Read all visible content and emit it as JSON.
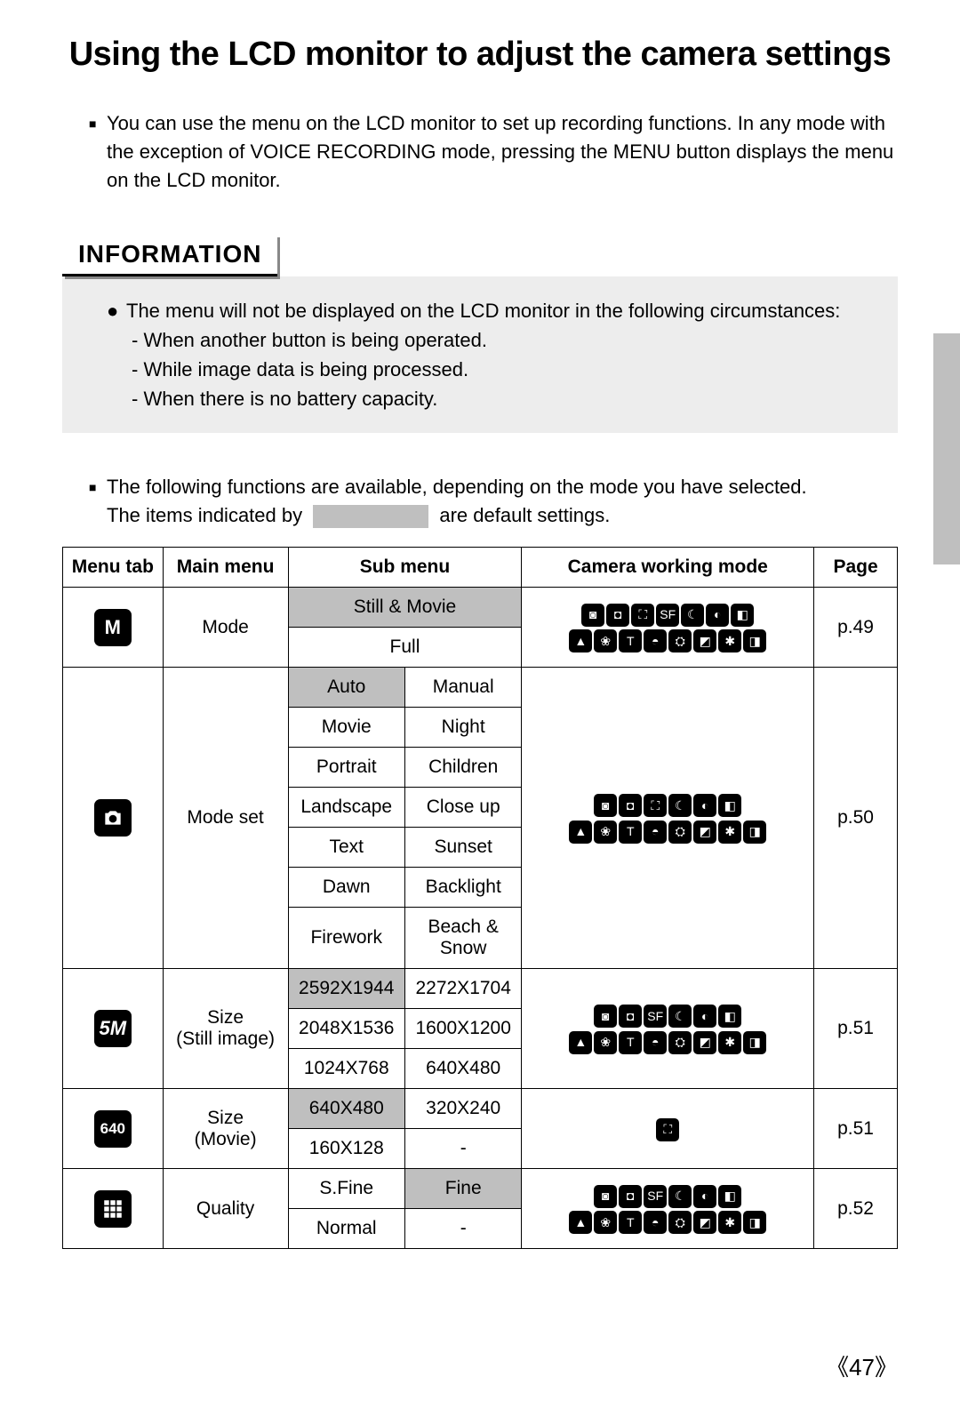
{
  "title": "Using the LCD monitor to adjust the camera settings",
  "intro": "You can use the menu on the LCD monitor to set up recording functions. In any mode with the exception of VOICE RECORDING mode, pressing the MENU button displays the menu on the LCD monitor.",
  "info_heading": "INFORMATION",
  "info_lead": "The menu will not be displayed on the LCD monitor in the following circumstances:",
  "info_items": [
    "- When another button is being operated.",
    "- While image data is being processed.",
    "- When there is no battery capacity."
  ],
  "functions_intro_a": "The following functions are available, depending on the mode you have selected.",
  "functions_intro_b_pre": "The items indicated by",
  "functions_intro_b_post": "are default settings.",
  "headers": {
    "menu_tab": "Menu tab",
    "main_menu": "Main menu",
    "sub_menu": "Sub menu",
    "camera_mode": "Camera working mode",
    "page": "Page"
  },
  "rows": {
    "mode": {
      "icon_label": "M",
      "main": "Mode",
      "sub1": "Still & Movie",
      "sub2": "Full",
      "page": "p.49"
    },
    "modeset": {
      "main": "Mode set",
      "pairs": [
        [
          "Auto",
          "Manual"
        ],
        [
          "Movie",
          "Night"
        ],
        [
          "Portrait",
          "Children"
        ],
        [
          "Landscape",
          "Close up"
        ],
        [
          "Text",
          "Sunset"
        ],
        [
          "Dawn",
          "Backlight"
        ],
        [
          "Firework",
          "Beach & Snow"
        ]
      ],
      "page": "p.50"
    },
    "size_still": {
      "icon_label": "5M",
      "main_a": "Size",
      "main_b": "(Still image)",
      "pairs": [
        [
          "2592X1944",
          "2272X1704"
        ],
        [
          "2048X1536",
          "1600X1200"
        ],
        [
          "1024X768",
          "640X480"
        ]
      ],
      "page": "p.51"
    },
    "size_movie": {
      "icon_label": "640",
      "main_a": "Size",
      "main_b": "(Movie)",
      "pairs": [
        [
          "640X480",
          "320X240"
        ],
        [
          "160X128",
          "-"
        ]
      ],
      "page": "p.51"
    },
    "quality": {
      "main": "Quality",
      "pairs": [
        [
          "S.Fine",
          "Fine"
        ],
        [
          "Normal",
          "-"
        ]
      ],
      "page": "p.52"
    }
  },
  "page_number": "《47》",
  "mode_icon_names": [
    "auto-icon",
    "manual-icon",
    "movie-icon",
    "sf-icon",
    "night-icon",
    "portrait-icon",
    "children-icon",
    "landscape-icon",
    "closeup-icon",
    "text-icon",
    "sunset-icon",
    "dawn-icon",
    "backlight-icon",
    "firework-icon",
    "beachsnow-icon"
  ]
}
